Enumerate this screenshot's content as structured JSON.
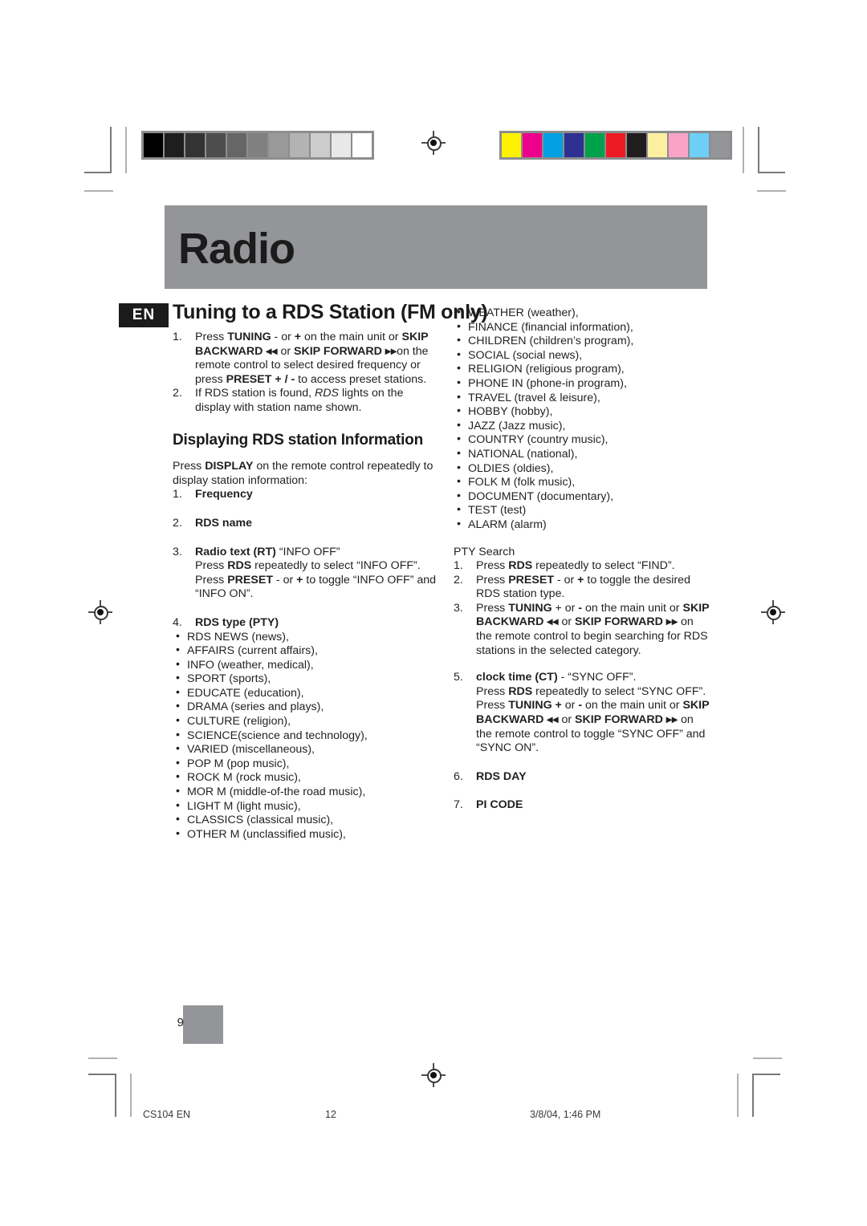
{
  "document": {
    "chapter_title": "Radio",
    "language_tag": "EN",
    "section_title": "Tuning to a RDS Station (FM only)",
    "page_number": "9"
  },
  "calibration": {
    "grayscale_swatches": [
      "#000000",
      "#1e1e1e",
      "#333333",
      "#4d4d4d",
      "#666666",
      "#808080",
      "#999999",
      "#b3b3b3",
      "#cccccc",
      "#e8e8e8",
      "#ffffff"
    ],
    "color_swatches": [
      "#fff200",
      "#ec008c",
      "#00a0e3",
      "#2e3192",
      "#00a14b",
      "#ed1c24",
      "#211d1e",
      "#fcf0a0",
      "#f9a3c7",
      "#6dcff6",
      "#939598"
    ]
  },
  "left_column": {
    "steps": [
      {
        "num": "1.",
        "parts": [
          {
            "t": "Press ",
            "b": false
          },
          {
            "t": "TUNING",
            "b": true
          },
          {
            "t": " - or ",
            "b": false
          },
          {
            "t": "+",
            "b": true
          },
          {
            "t": " on the main unit or ",
            "b": false
          },
          {
            "t": "SKIP BACKWARD",
            "b": true
          },
          {
            "t": " ◂◂ ",
            "b": true
          },
          {
            "t": "or ",
            "b": false
          },
          {
            "t": "SKIP FORWARD",
            "b": true
          },
          {
            "t": " ▸▸",
            "b": true
          },
          {
            "t": "on the remote control to select desired frequency or press ",
            "b": false
          },
          {
            "t": "PRESET + / -",
            "b": true
          },
          {
            "t": " to access preset stations.",
            "b": false
          }
        ]
      },
      {
        "num": "2.",
        "parts": [
          {
            "t": "If RDS station is found, ",
            "b": false
          },
          {
            "t": "RDS",
            "b": false,
            "i": true
          },
          {
            "t": " lights on the display with station name shown.",
            "b": false
          }
        ]
      }
    ],
    "sub_heading": "Displaying RDS station Information",
    "intro": [
      {
        "t": "Press ",
        "b": false
      },
      {
        "t": "DISPLAY",
        "b": true
      },
      {
        "t": " on the remote control repeatedly to display station information:",
        "b": false
      }
    ],
    "info_items": [
      {
        "num": "1.",
        "title": "Frequency",
        "body": []
      },
      {
        "num": "2.",
        "title": "RDS name",
        "body": []
      },
      {
        "num": "3.",
        "title": "Radio text (RT)",
        "title_suffix": " “INFO OFF”",
        "body": [
          {
            "t": "Press ",
            "b": false
          },
          {
            "t": "RDS",
            "b": true
          },
          {
            "t": " repeatedly to select “INFO OFF”. Press ",
            "b": false
          },
          {
            "t": "PRESET",
            "b": true
          },
          {
            "t": " - or ",
            "b": false
          },
          {
            "t": "+",
            "b": true
          },
          {
            "t": " to toggle “INFO OFF” and “INFO ON”.",
            "b": false
          }
        ]
      },
      {
        "num": "4.",
        "title": "RDS type (PTY)",
        "body": []
      }
    ],
    "pty_list": [
      "RDS NEWS (news),",
      "AFFAIRS (current affairs),",
      "INFO (weather, medical),",
      "SPORT (sports),",
      "EDUCATE (education),",
      "DRAMA (series and plays),",
      "CULTURE (religion),",
      "SCIENCE(science and technology),",
      "VARIED (miscellaneous),",
      "POP M (pop music),",
      "ROCK M (rock music),",
      "MOR M (middle-of-the road music),",
      "LIGHT M (light music),",
      "CLASSICS (classical music),",
      "OTHER M (unclassified music),"
    ]
  },
  "right_column": {
    "pty_list": [
      "WEATHER (weather),",
      "FINANCE (financial information),",
      "CHILDREN (children’s program),",
      "SOCIAL (social news),",
      "RELIGION (religious program),",
      "PHONE IN (phone-in program),",
      "TRAVEL (travel & leisure),",
      "HOBBY (hobby),",
      "JAZZ (Jazz music),",
      "COUNTRY (country music),",
      "NATIONAL (national),",
      "OLDIES (oldies),",
      "FOLK M (folk music),",
      "DOCUMENT (documentary),",
      "TEST (test)",
      "ALARM (alarm)"
    ],
    "pty_search_heading": "PTY Search",
    "pty_search_steps": [
      {
        "num": "1.",
        "parts": [
          {
            "t": "Press ",
            "b": false
          },
          {
            "t": "RDS",
            "b": true
          },
          {
            "t": " repeatedly to select “FIND”.",
            "b": false
          }
        ]
      },
      {
        "num": "2.",
        "parts": [
          {
            "t": "Press ",
            "b": false
          },
          {
            "t": "PRESET",
            "b": true
          },
          {
            "t": " - or ",
            "b": false
          },
          {
            "t": "+",
            "b": true
          },
          {
            "t": " to toggle the desired RDS station type.",
            "b": false
          }
        ]
      },
      {
        "num": "3.",
        "parts": [
          {
            "t": "Press ",
            "b": false
          },
          {
            "t": "TUNING",
            "b": true
          },
          {
            "t": " + or ",
            "b": false
          },
          {
            "t": "-",
            "b": true
          },
          {
            "t": " on the main unit or ",
            "b": false
          },
          {
            "t": "SKIP BACKWARD",
            "b": true
          },
          {
            "t": " ◂◂ ",
            "b": true
          },
          {
            "t": "or ",
            "b": false
          },
          {
            "t": "SKIP FORWARD",
            "b": true
          },
          {
            "t": " ▸▸",
            "b": true
          },
          {
            "t": " on the remote control to begin searching for RDS stations in the selected category.",
            "b": false
          }
        ]
      }
    ],
    "info_items": [
      {
        "num": "5.",
        "title": "clock time (CT)",
        "title_suffix": " - “SYNC OFF”.",
        "body": [
          {
            "t": "Press ",
            "b": false
          },
          {
            "t": "RDS",
            "b": true
          },
          {
            "t": " repeatedly to select “SYNC OFF”. Press ",
            "b": false
          },
          {
            "t": "TUNING +",
            "b": true
          },
          {
            "t": " or ",
            "b": false
          },
          {
            "t": "-",
            "b": true
          },
          {
            "t": " on the main unit or ",
            "b": false
          },
          {
            "t": "SKIP BACKWARD",
            "b": true
          },
          {
            "t": " ◂◂ ",
            "b": true
          },
          {
            "t": "or ",
            "b": false
          },
          {
            "t": "SKIP FORWARD",
            "b": true
          },
          {
            "t": " ▸▸",
            "b": true
          },
          {
            "t": " on the remote control to toggle “SYNC OFF” and “SYNC ON”.",
            "b": false
          }
        ]
      },
      {
        "num": "6.",
        "title": "RDS DAY",
        "body": []
      },
      {
        "num": "7.",
        "title": "PI CODE",
        "body": []
      }
    ]
  },
  "footer": {
    "left": "CS104 EN",
    "middle": "12",
    "right": "3/8/04, 1:46 PM"
  }
}
